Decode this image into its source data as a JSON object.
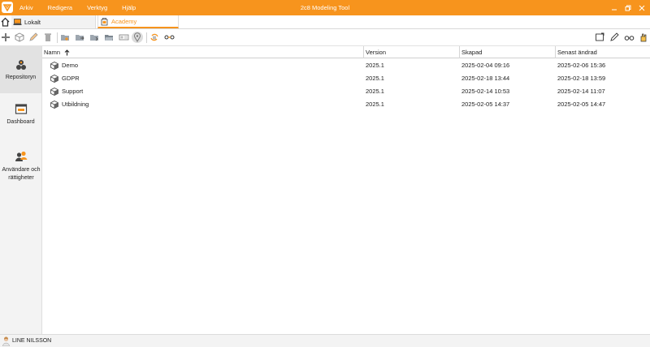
{
  "window": {
    "title": "2c8 Modeling Tool"
  },
  "menu": [
    "Arkiv",
    "Redigera",
    "Verktyg",
    "Hjälp"
  ],
  "tabs": [
    {
      "label": "Lokalt"
    },
    {
      "label": "Academy"
    }
  ],
  "sidenav": [
    {
      "label": "Repositoryn"
    },
    {
      "label": "Dashboard"
    },
    {
      "label": "Användare och rättigheter"
    }
  ],
  "table": {
    "columns": [
      "Namn",
      "Version",
      "Skapad",
      "Senast ändrad"
    ],
    "rows": [
      {
        "name": "Demo",
        "version": "2025.1",
        "created": "2025-02-04 09:16",
        "modified": "2025-02-06 15:36"
      },
      {
        "name": "GDPR",
        "version": "2025.1",
        "created": "2025-02-18 13:44",
        "modified": "2025-02-18 13:59"
      },
      {
        "name": "Support",
        "version": "2025.1",
        "created": "2025-02-14 10:53",
        "modified": "2025-02-14 11:07"
      },
      {
        "name": "Utbildning",
        "version": "2025.1",
        "created": "2025-02-05 14:37",
        "modified": "2025-02-05 14:47"
      }
    ]
  },
  "status": {
    "user": "LINE NILSSON"
  },
  "colors": {
    "accent": "#f7941d"
  }
}
